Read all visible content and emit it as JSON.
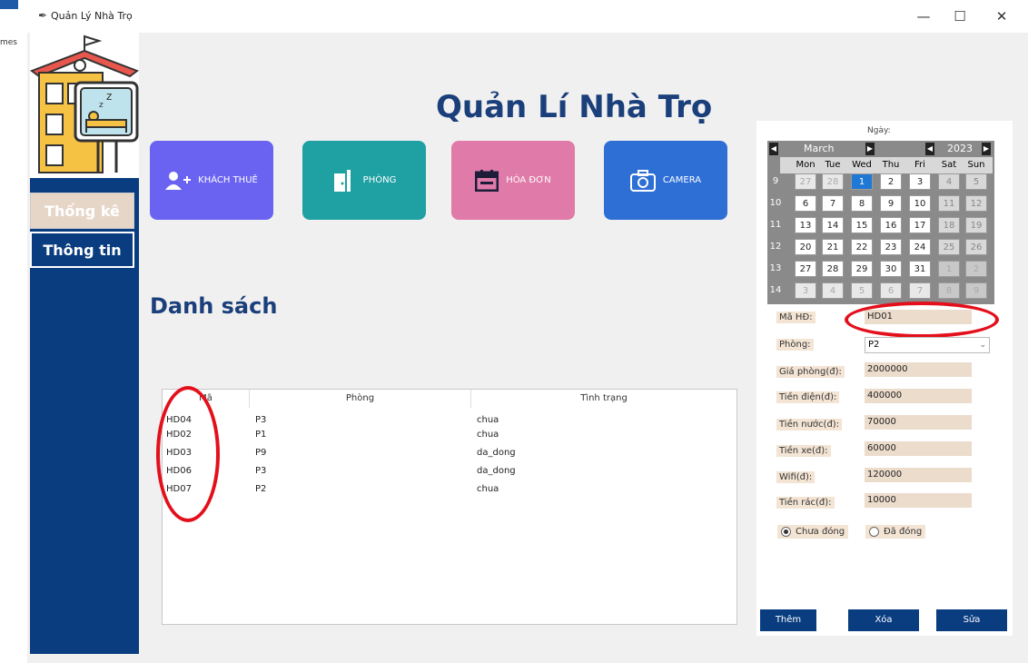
{
  "window": {
    "title": "Quản Lý Nhà Trọ",
    "controls": {
      "minimize": "—",
      "maximize": "☐",
      "close": "✕"
    },
    "behind_text": "mes"
  },
  "sidebar": {
    "items": [
      {
        "label": "Thống kê"
      },
      {
        "label": "Thông tin"
      }
    ]
  },
  "header": {
    "title": "Quản Lí Nhà Trọ"
  },
  "nav": [
    {
      "label": "KHÁCH THUÊ",
      "icon": "add-user-icon",
      "color": "#6a63f2"
    },
    {
      "label": "PHÒNG",
      "icon": "door-icon",
      "color": "#1fa0a3"
    },
    {
      "label": "HÓA ĐƠN",
      "icon": "calendar-icon",
      "color": "#e07aa8"
    },
    {
      "label": "CAMERA",
      "icon": "camera-icon",
      "color": "#2e6fd6"
    }
  ],
  "list": {
    "title": "Danh sách",
    "columns": [
      "Mã",
      "Phòng",
      "Tình trạng"
    ],
    "rows": [
      {
        "ma": "HD04",
        "phong": "P3",
        "tinhtrang": "chua"
      },
      {
        "ma": "HD02",
        "phong": "P1",
        "tinhtrang": "chua"
      },
      {
        "ma": "HD03",
        "phong": "P9",
        "tinhtrang": "da_dong"
      },
      {
        "ma": "HD06",
        "phong": "P3",
        "tinhtrang": "da_dong"
      },
      {
        "ma": "HD07",
        "phong": "P2",
        "tinhtrang": "chua"
      }
    ]
  },
  "calendar": {
    "label": "Ngày:",
    "month": "March",
    "year": "2023",
    "weekdays": [
      "Mon",
      "Tue",
      "Wed",
      "Thu",
      "Fri",
      "Sat",
      "Sun"
    ],
    "weeks": [
      {
        "num": "9",
        "days": [
          "27",
          "28",
          "1",
          "2",
          "3",
          "4",
          "5"
        ]
      },
      {
        "num": "10",
        "days": [
          "6",
          "7",
          "8",
          "9",
          "10",
          "11",
          "12"
        ]
      },
      {
        "num": "11",
        "days": [
          "13",
          "14",
          "15",
          "16",
          "17",
          "18",
          "19"
        ]
      },
      {
        "num": "12",
        "days": [
          "20",
          "21",
          "22",
          "23",
          "24",
          "25",
          "26"
        ]
      },
      {
        "num": "13",
        "days": [
          "27",
          "28",
          "29",
          "30",
          "31",
          "1",
          "2"
        ]
      },
      {
        "num": "14",
        "days": [
          "3",
          "4",
          "5",
          "6",
          "7",
          "8",
          "9"
        ]
      }
    ],
    "selected": "1"
  },
  "form": {
    "ma_hd": {
      "label": "Mã HĐ:",
      "value": "HD01"
    },
    "phong": {
      "label": "Phòng:",
      "value": "P2"
    },
    "gia_phong": {
      "label": "Giá phòng(đ):",
      "value": "2000000"
    },
    "tien_dien": {
      "label": "Tiền điện(đ):",
      "value": "400000"
    },
    "tien_nuoc": {
      "label": "Tiền nước(đ):",
      "value": "70000"
    },
    "tien_xe": {
      "label": "Tiền xe(đ):",
      "value": "60000"
    },
    "wifi": {
      "label": "Wifi(đ):",
      "value": "120000"
    },
    "tien_rac": {
      "label": "Tiền rác(đ):",
      "value": "10000"
    },
    "status_options": {
      "chua": "Chưa đóng",
      "da": "Đã đóng"
    }
  },
  "actions": {
    "them": "Thêm",
    "xoa": "Xóa",
    "sua": "Sửa"
  }
}
